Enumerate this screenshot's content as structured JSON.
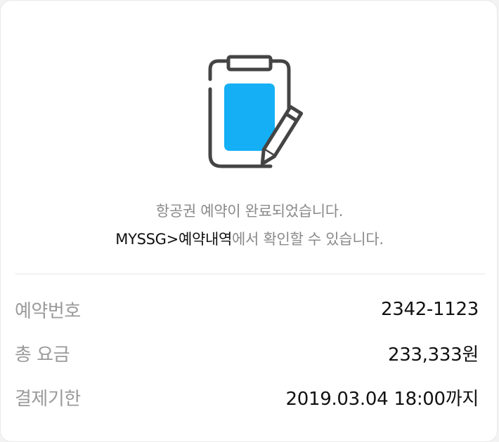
{
  "illustration": {
    "icon": "clipboard-pencil-icon",
    "accent_color": "#14aff5",
    "stroke_color": "#444444"
  },
  "message": {
    "line1": "항공권 예약이 완료되었습니다.",
    "link_text": "MYSSG>예약내역",
    "line2_rest": "에서 확인할 수 있습니다."
  },
  "details": [
    {
      "label": "예약번호",
      "value": "2342-1123"
    },
    {
      "label": "총 요금",
      "value": "233,333원"
    },
    {
      "label": "결제기한",
      "value": "2019.03.04 18:00까지"
    }
  ]
}
